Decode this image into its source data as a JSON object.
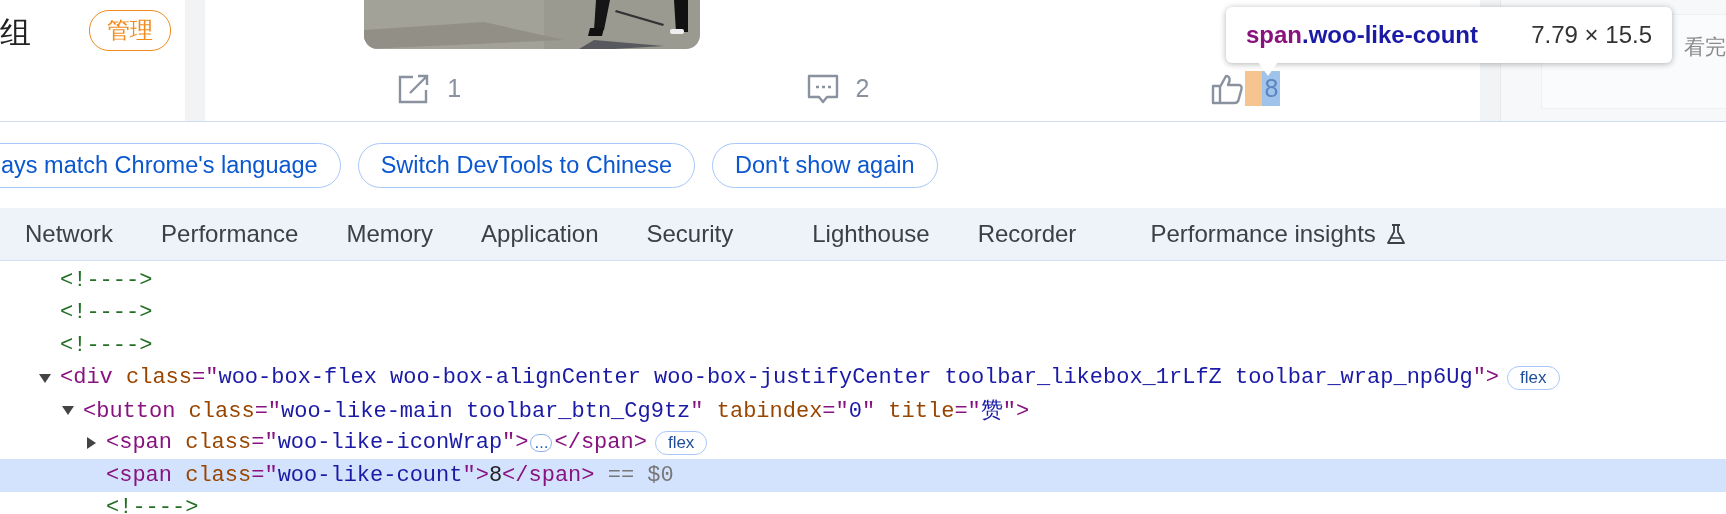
{
  "sidebar": {
    "heading": "组",
    "manage_badge": "管理"
  },
  "post": {
    "actions": [
      {
        "kind": "share",
        "count": "1",
        "highlighted": false
      },
      {
        "kind": "comment",
        "count": "2",
        "highlighted": false
      },
      {
        "kind": "like",
        "count": "8",
        "highlighted": true
      }
    ]
  },
  "right_panel": {
    "text": "看完"
  },
  "inspect_tooltip": {
    "tag": "span",
    "class_name": ".woo-like-count",
    "size": "7.79 × 15.5"
  },
  "language_infobar": {
    "buttons": [
      "ays match Chrome's language",
      "Switch DevTools to Chinese",
      "Don't show again"
    ]
  },
  "tabs": [
    {
      "label": "Network",
      "experimental": false
    },
    {
      "label": "Performance",
      "experimental": false
    },
    {
      "label": "Memory",
      "experimental": false
    },
    {
      "label": "Application",
      "experimental": false
    },
    {
      "label": "Security",
      "experimental": false
    },
    {
      "label": "Lighthouse",
      "experimental": false
    },
    {
      "label": "Recorder",
      "experimental": false
    },
    {
      "label": "Performance insights",
      "experimental": true
    }
  ],
  "elements_tree": [
    {
      "selected": false,
      "tokens": [
        {
          "comment": "<!---->"
        }
      ]
    },
    {
      "selected": false,
      "tokens": [
        {
          "comment": "<!---->"
        }
      ]
    },
    {
      "selected": false,
      "tokens": [
        {
          "comment": "<!---->"
        }
      ]
    },
    {
      "selected": false,
      "expanded": true,
      "tokens": [
        {
          "tag": "<div"
        },
        {
          "attr": " class"
        },
        {
          "tag": "=\""
        },
        {
          "value": "woo-box-flex woo-box-alignCenter woo-box-justifyCenter toolbar_likebox_1rLfZ toolbar_wrap_np6Ug"
        },
        {
          "tag": "\">"
        },
        {
          "badge": "flex"
        }
      ],
      "children": [
        {
          "selected": false,
          "expanded": true,
          "tokens": [
            {
              "tag": "<button"
            },
            {
              "attr": " class"
            },
            {
              "tag": "=\""
            },
            {
              "value": "woo-like-main toolbar_btn_Cg9tz"
            },
            {
              "tag": "\""
            },
            {
              "attr": " tabindex"
            },
            {
              "tag": "=\""
            },
            {
              "value": "0"
            },
            {
              "tag": "\""
            },
            {
              "attr": " title"
            },
            {
              "tag": "=\""
            },
            {
              "value": "赞"
            },
            {
              "tag": "\">"
            }
          ],
          "children": [
            {
              "selected": false,
              "expanded": false,
              "tokens": [
                {
                  "tag": "<span"
                },
                {
                  "attr": " class"
                },
                {
                  "tag": "=\""
                },
                {
                  "value": "woo-like-iconWrap"
                },
                {
                  "tag": "\">"
                },
                {
                  "ellipsis": "…"
                },
                {
                  "tag": "</span>"
                },
                {
                  "badge": "flex"
                }
              ]
            },
            {
              "selected": true,
              "tokens": [
                {
                  "tag": "<span"
                },
                {
                  "attr": " class"
                },
                {
                  "tag": "=\""
                },
                {
                  "value": "woo-like-count"
                },
                {
                  "tag": "\">"
                },
                {
                  "text": "8"
                },
                {
                  "tag": "</span>"
                },
                {
                  "marker": " == $0"
                }
              ]
            },
            {
              "selected": false,
              "tokens": [
                {
                  "comment": "<!---->"
                }
              ]
            }
          ]
        }
      ]
    }
  ]
}
